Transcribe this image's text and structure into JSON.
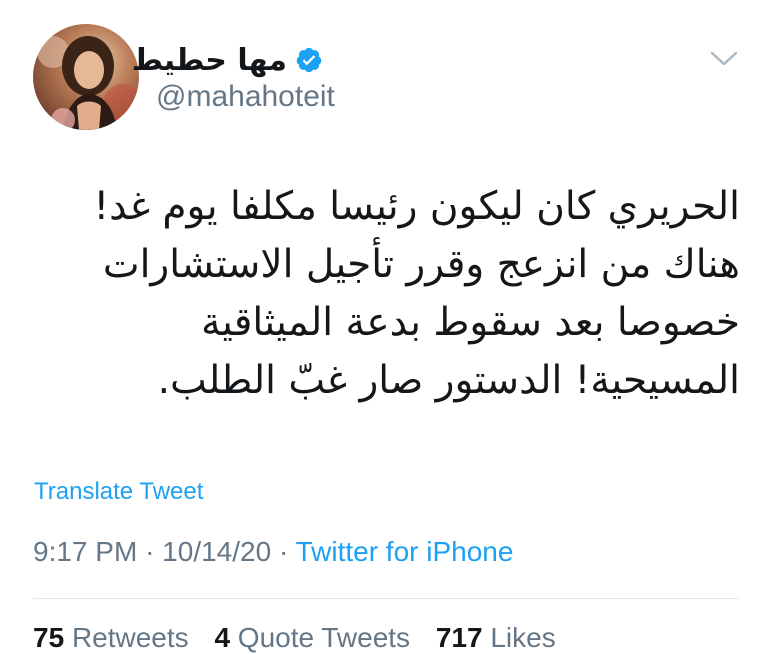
{
  "author": {
    "display_name": "مها حطيط",
    "handle": "@mahahoteit",
    "verified": true
  },
  "tweet": {
    "text": "الحريري كان ليكون رئيسا مكلفا يوم غد! هناك من انزعج وقرر تأجيل الاستشارات خصوصا بعد سقوط بدعة الميثاقية المسيحية! الدستور صار غبّ الطلب."
  },
  "actions": {
    "translate_label": "Translate Tweet"
  },
  "meta": {
    "time": "9:17 PM",
    "separator": "·",
    "date": "10/14/20",
    "source": "Twitter for iPhone"
  },
  "stats": {
    "retweets_count": "75",
    "retweets_label": "Retweets",
    "quotes_count": "4",
    "quotes_label": "Quote Tweets",
    "likes_count": "717",
    "likes_label": "Likes"
  },
  "icons": {
    "verified": "verified-badge-icon",
    "menu": "chevron-down-icon"
  },
  "colors": {
    "accent": "#1da1f2",
    "text_primary": "#14171a",
    "text_secondary": "#657786",
    "divider": "#e1e8ed"
  }
}
